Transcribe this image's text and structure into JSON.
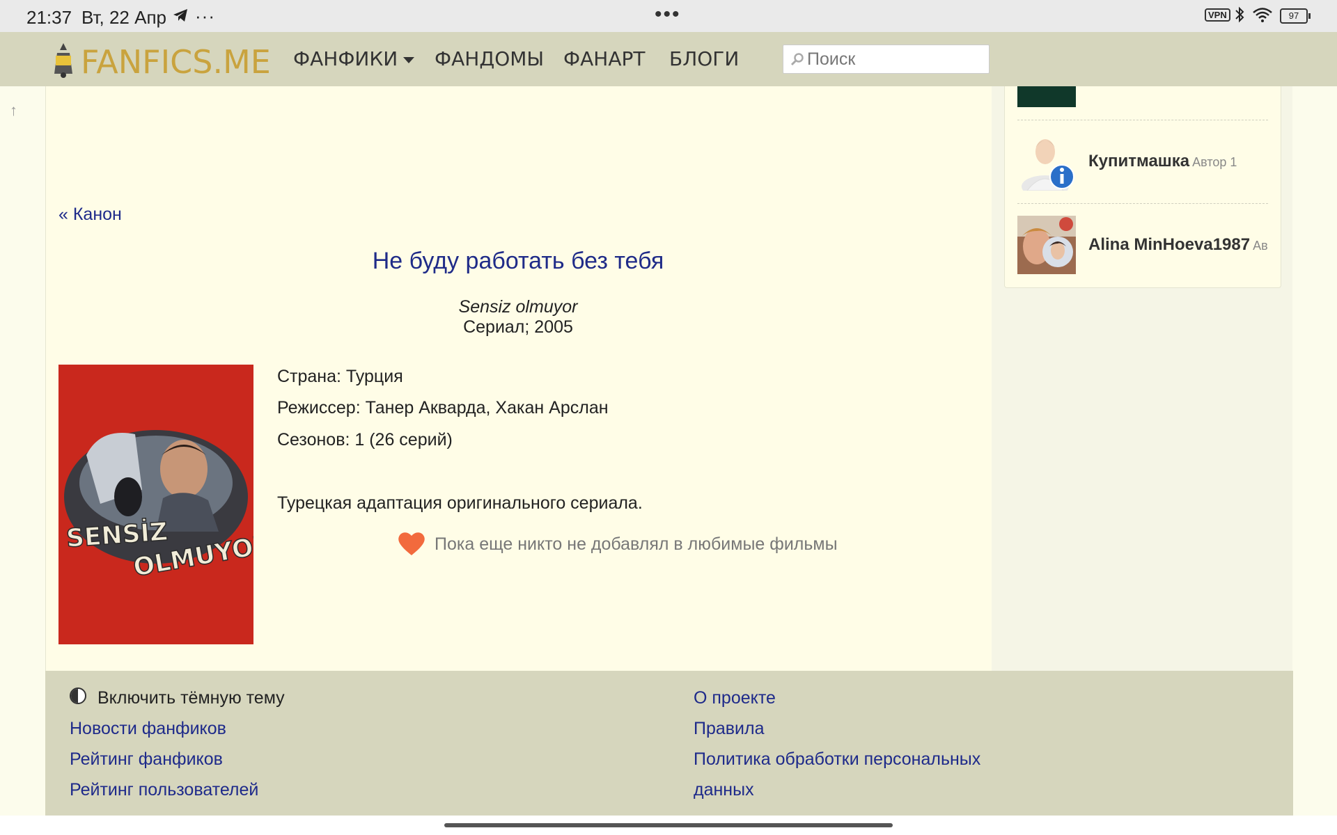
{
  "status_bar": {
    "time": "21:37",
    "date": "Вт, 22 Апр",
    "more": "···",
    "vpn": "VPN",
    "battery": "97"
  },
  "nav": {
    "logo": "FANFICS.ME",
    "items": [
      {
        "label": "ФАНФИКИ",
        "has_dropdown": true
      },
      {
        "label": "ФАНДОМЫ"
      },
      {
        "label": "ФАНАРТ"
      },
      {
        "label": "БЛОГИ"
      }
    ],
    "search_placeholder": "Поиск"
  },
  "sidebar": {
    "users": [
      {
        "name": "Купитмашка",
        "role": "Автор 1"
      },
      {
        "name": "Alina MinHoeva1987",
        "role": "Ав"
      }
    ]
  },
  "content": {
    "back_link": "« Канон",
    "title": "Не буду работать без тебя",
    "original_title": "Sensiz olmuyor",
    "meta": "Сериал; 2005",
    "poster_text": [
      "SENSİZ",
      "OLMUYOR"
    ],
    "country": "Страна: Турция",
    "director": "Режиссер: Танер Акварда, Хакан Арслан",
    "seasons": "Сезонов: 1 (26 серий)",
    "description": "Турецкая адаптация оригинального сериала.",
    "favorites": "Пока еще никто не добавлял в любимые фильмы"
  },
  "footer": {
    "theme_toggle": "Включить тёмную тему",
    "left_links": [
      "Новости фанфиков",
      "Рейтинг фанфиков",
      "Рейтинг пользователей"
    ],
    "right_links": [
      "О проекте",
      "Правила",
      "Политика обработки персональных",
      "данных"
    ]
  },
  "colors": {
    "nav_bg": "#d6d6bd",
    "page_bg": "#fffde7",
    "link": "#1e2a8a",
    "logo": "#c9a33e"
  }
}
